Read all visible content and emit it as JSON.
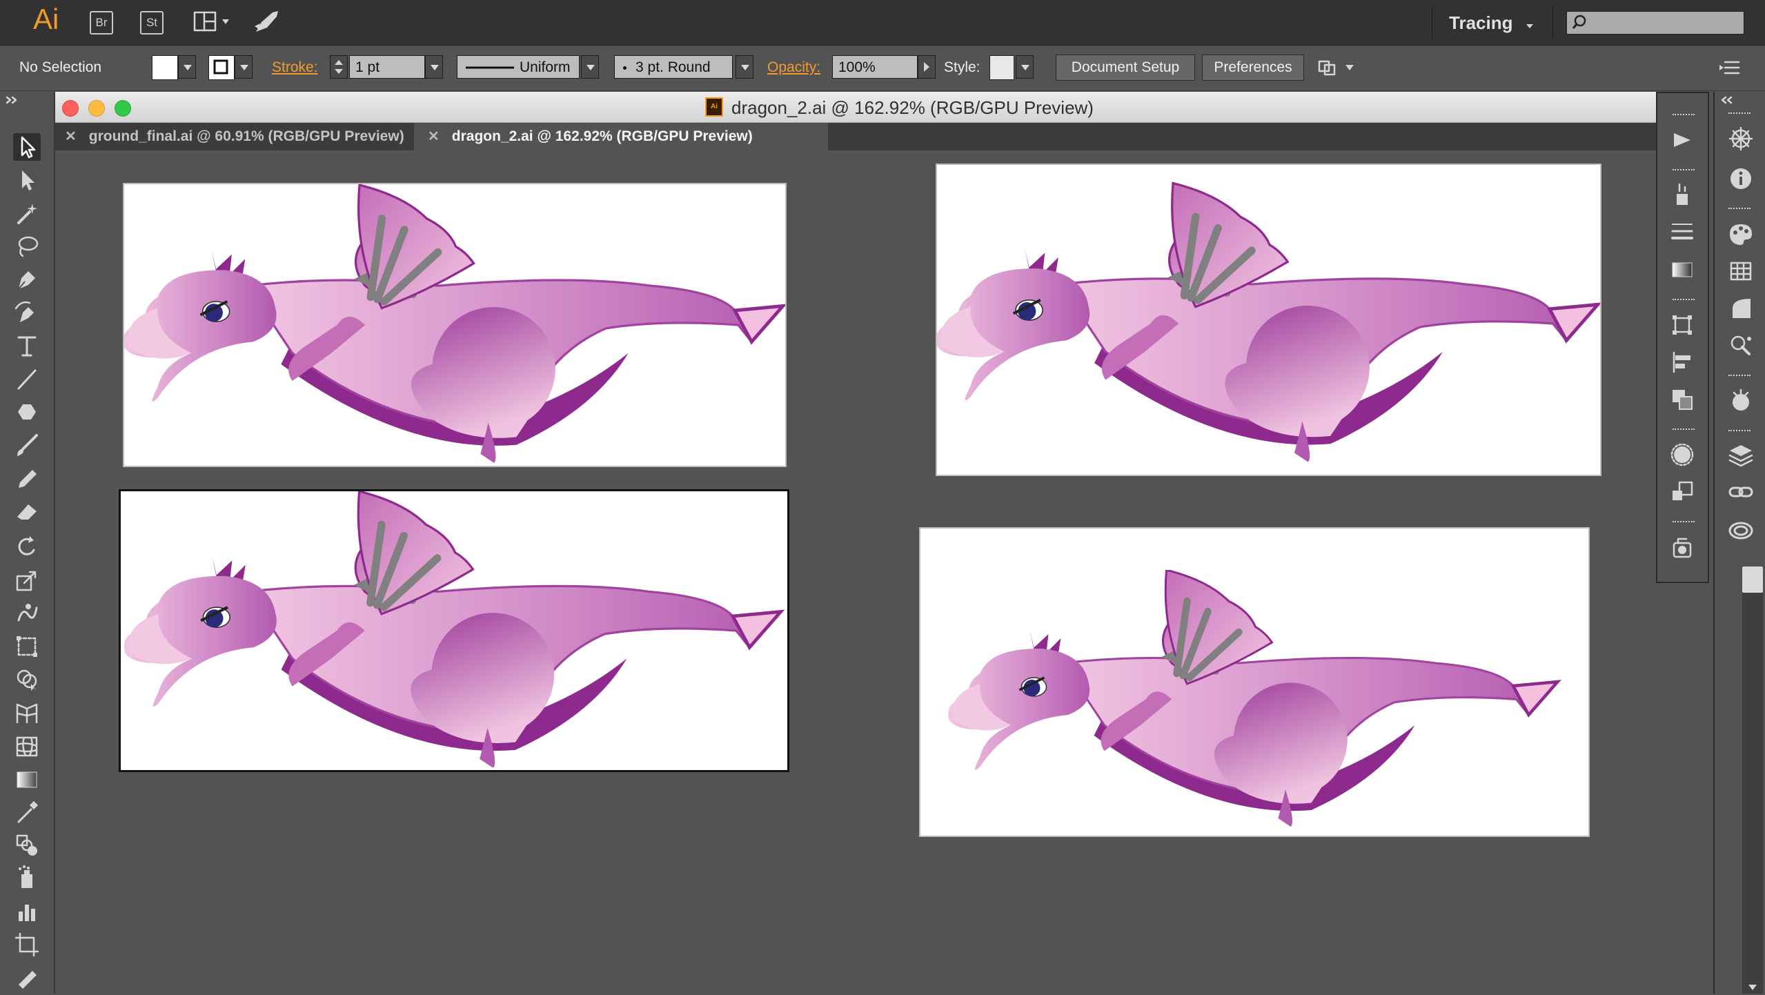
{
  "app": {
    "logo": "Ai",
    "bridge_label": "Br",
    "stock_label": "St",
    "workspace": "Tracing"
  },
  "control_bar": {
    "selection_status": "No Selection",
    "stroke_label": "Stroke:",
    "stroke_weight": "1 pt",
    "profile": "Uniform",
    "brush": "3 pt. Round",
    "opacity_label": "Opacity:",
    "opacity_value": "100%",
    "style_label": "Style:",
    "document_setup": "Document Setup",
    "preferences": "Preferences"
  },
  "window": {
    "title": "dragon_2.ai @ 162.92% (RGB/GPU Preview)",
    "file_icon": "Ai"
  },
  "tabs": [
    {
      "label": "ground_final.ai @ 60.91% (RGB/GPU Preview)",
      "active": false
    },
    {
      "label": "dragon_2.ai @ 162.92% (RGB/GPU Preview)",
      "active": true
    }
  ],
  "colors": {
    "accent_orange": "#f29a25",
    "dragon_light": "#eab8d8",
    "dragon_mid": "#c46eb8",
    "dragon_dark": "#8e2a8e",
    "wing_stripe": "#808080"
  },
  "tools": [
    "selection-icon",
    "direct-selection-icon",
    "magic-wand-icon",
    "lasso-icon",
    "pen-icon",
    "curvature-icon",
    "type-icon",
    "line-icon",
    "polygon-icon",
    "paintbrush-icon",
    "pencil-icon",
    "eraser-icon",
    "rotate-icon",
    "scale-icon",
    "warp-icon",
    "free-transform-icon",
    "shape-builder-icon",
    "perspective-grid-icon",
    "mesh-icon",
    "gradient-icon",
    "eyedropper-icon",
    "blend-icon",
    "symbol-sprayer-icon",
    "column-graph-icon",
    "artboard-icon",
    "slice-icon"
  ]
}
